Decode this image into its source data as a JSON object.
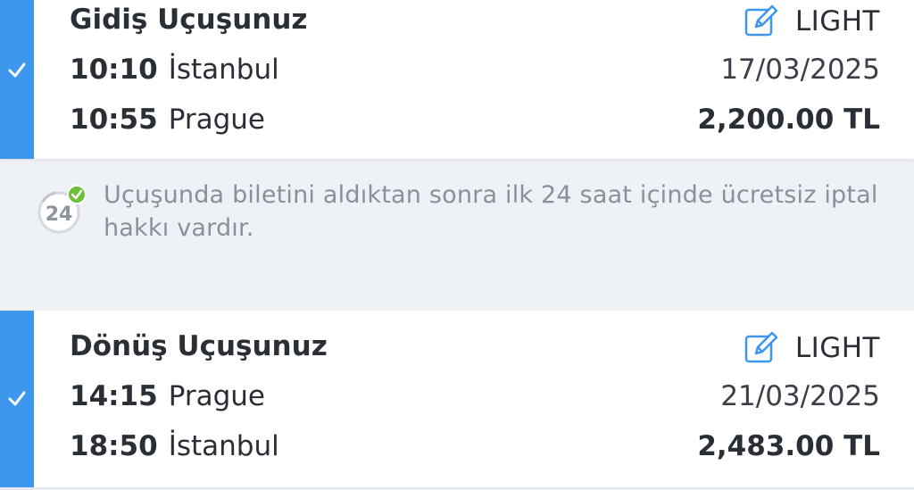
{
  "outbound": {
    "title": "Gidiş Uçuşunuz",
    "fare_class": "LIGHT",
    "departure_time": "10:10",
    "departure_city": "İstanbul",
    "arrival_time": "10:55",
    "arrival_city": "Prague",
    "date": "17/03/2025",
    "price": "2,200.00 TL"
  },
  "notice": {
    "text": "Uçuşunda biletini aldıktan sonra ilk 24 saat içinde ücretsiz iptal hakkı vardır.",
    "badge_number": "24"
  },
  "return": {
    "title": "Dönüş Uçuşunuz",
    "fare_class": "LIGHT",
    "departure_time": "14:15",
    "departure_city": "Prague",
    "arrival_time": "18:50",
    "arrival_city": "İstanbul",
    "date": "21/03/2025",
    "price": "2,483.00 TL"
  },
  "icons": {
    "selected": "checkmark-icon",
    "edit": "edit-icon",
    "free_cancel": "24h-cancel-icon"
  },
  "colors": {
    "accent": "#3d97ec",
    "badge_green": "#6cbf3a",
    "notice_text": "#8a919b",
    "background": "#eef1f5"
  }
}
